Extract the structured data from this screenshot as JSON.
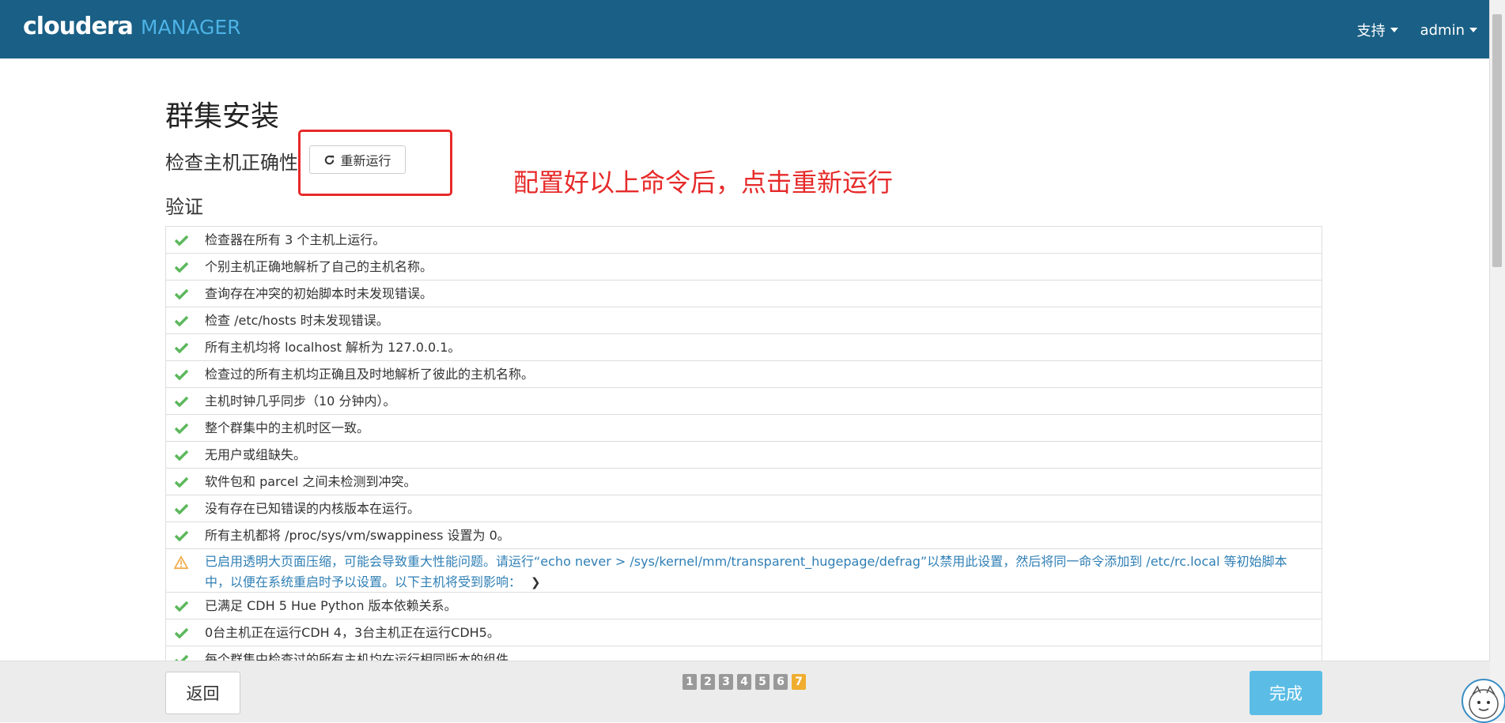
{
  "header": {
    "brand": "cloudera",
    "product": "MANAGER",
    "nav": [
      {
        "label": "支持"
      },
      {
        "label": "admin"
      }
    ]
  },
  "page": {
    "title": "群集安装",
    "subhead": "检查主机正确性",
    "rerun_label": "重新运行",
    "verify_head": "验证"
  },
  "annotation": {
    "text": "配置好以上命令后，点击重新运行"
  },
  "checks": [
    {
      "status": "ok",
      "text": "检查器在所有 3 个主机上运行。"
    },
    {
      "status": "ok",
      "text": "个别主机正确地解析了自己的主机名称。"
    },
    {
      "status": "ok",
      "text": "查询存在冲突的初始脚本时未发现错误。"
    },
    {
      "status": "ok",
      "text": "检查 /etc/hosts 时未发现错误。"
    },
    {
      "status": "ok",
      "text": "所有主机均将 localhost 解析为 127.0.0.1。"
    },
    {
      "status": "ok",
      "text": "检查过的所有主机均正确且及时地解析了彼此的主机名称。"
    },
    {
      "status": "ok",
      "text": "主机时钟几乎同步（10 分钟内）。"
    },
    {
      "status": "ok",
      "text": "整个群集中的主机时区一致。"
    },
    {
      "status": "ok",
      "text": "无用户或组缺失。"
    },
    {
      "status": "ok",
      "text": "软件包和 parcel 之间未检测到冲突。"
    },
    {
      "status": "ok",
      "text": "没有存在已知错误的内核版本在运行。"
    },
    {
      "status": "ok",
      "text": "所有主机都将 /proc/sys/vm/swappiness 设置为 0。"
    },
    {
      "status": "warn",
      "text": "已启用透明大页面压缩，可能会导致重大性能问题。请运行“echo never > /sys/kernel/mm/transparent_hugepage/defrag”以禁用此设置，然后将同一命令添加到 /etc/rc.local 等初始脚本中，以便在系统重启时予以设置。以下主机将受到影响："
    },
    {
      "status": "ok",
      "text": "已满足 CDH 5 Hue Python 版本依赖关系。"
    },
    {
      "status": "ok",
      "text": "0台主机正在运行CDH 4，3台主机正在运行CDH5。"
    },
    {
      "status": "ok",
      "text": "每个群集中检查过的所有主机均在运行相同版本的组件。"
    }
  ],
  "footer": {
    "back_label": "返回",
    "finish_label": "完成",
    "steps": [
      "1",
      "2",
      "3",
      "4",
      "5",
      "6",
      "7"
    ],
    "active_step": "7"
  },
  "colors": {
    "header_bg": "#1a5f85",
    "ok_icon": "#5cb85c",
    "warn_icon": "#f0ad4e",
    "warn_text": "#2f7fb5",
    "annotation": "#e62a2a",
    "finish_bg": "#5bbde6",
    "active_step": "#f0ad2e"
  }
}
